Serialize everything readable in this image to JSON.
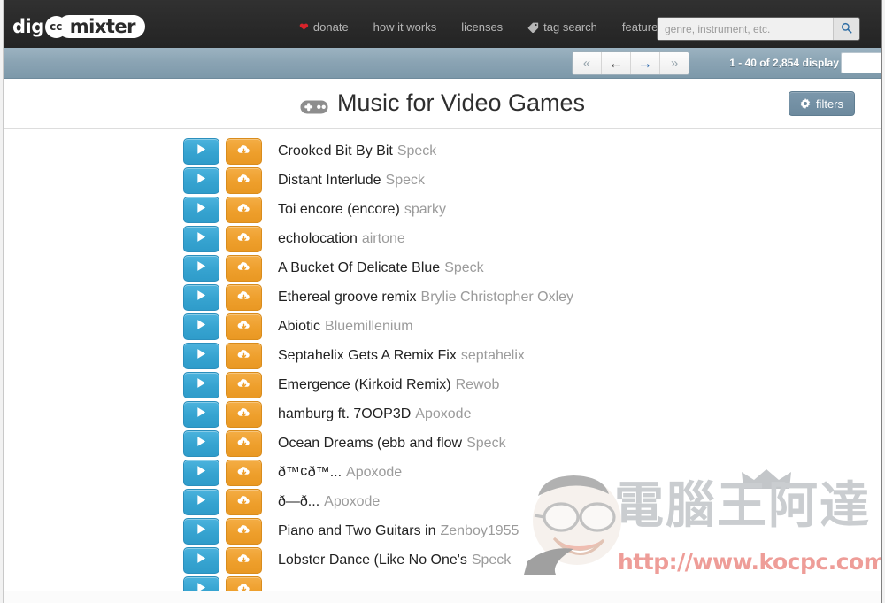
{
  "site": {
    "logo_part1": "dig",
    "logo_badge": "cc",
    "logo_part2": "mixter"
  },
  "header": {
    "nav": [
      {
        "label": "donate",
        "icon": "heart-icon"
      },
      {
        "label": "how it works",
        "icon": null
      },
      {
        "label": "licenses",
        "icon": null
      },
      {
        "label": "tag search",
        "icon": "tag-icon"
      },
      {
        "label": "featured",
        "icon": "chevron-down-icon"
      }
    ],
    "search": {
      "placeholder": "genre, instrument, etc.",
      "value": "",
      "button_icon": "search-icon"
    }
  },
  "toolbar": {
    "pager": [
      {
        "name": "first-page",
        "glyph": "«",
        "style": "muted"
      },
      {
        "name": "prev-page",
        "glyph": "←",
        "style": "dark"
      },
      {
        "name": "next-page",
        "glyph": "→",
        "style": "active"
      },
      {
        "name": "last-page",
        "glyph": "»",
        "style": "muted"
      }
    ],
    "results_text": "1 - 40 of 2,854",
    "display_label": "display",
    "display_value": ""
  },
  "main": {
    "title": "Music for Video Games",
    "title_icon": "gamepad-icon",
    "filters_label": "filters",
    "filters_icon": "gear-icon"
  },
  "tracks": [
    {
      "title": "Crooked Bit By Bit",
      "artist": "Speck"
    },
    {
      "title": "Distant Interlude",
      "artist": "Speck"
    },
    {
      "title": "Toi encore (encore)",
      "artist": "sparky"
    },
    {
      "title": "echolocation",
      "artist": "airtone"
    },
    {
      "title": "A Bucket Of Delicate Blue",
      "artist": "Speck"
    },
    {
      "title": "Ethereal groove remix",
      "artist": "Brylie Christopher Oxley"
    },
    {
      "title": "Abiotic",
      "artist": "Bluemillenium"
    },
    {
      "title": "Septahelix Gets A Remix Fix",
      "artist": "septahelix"
    },
    {
      "title": "Emergence (Kirkoid Remix)",
      "artist": "Rewob"
    },
    {
      "title": "hamburg ft. 7OOP3D",
      "artist": "Apoxode"
    },
    {
      "title": "Ocean Dreams (ebb and flow",
      "artist": "Speck"
    },
    {
      "title": "ð™¢ð™...",
      "artist": "Apoxode"
    },
    {
      "title": "ð—ð...",
      "artist": "Apoxode"
    },
    {
      "title": "Piano and Two Guitars in",
      "artist": "Zenboy1955"
    },
    {
      "title": "Lobster Dance (Like No One's",
      "artist": "Speck"
    },
    {
      "title": "",
      "artist": ""
    }
  ],
  "row_buttons": {
    "play_icon": "play-icon",
    "download_icon": "cloud-download-icon"
  },
  "watermark": {
    "text_cn": "電腦王阿達",
    "url": "http://www.kocpc.com.tw"
  },
  "colors": {
    "header_bg": "#2b2b2b",
    "toolbar_bg": "#8ba4b4",
    "play_blue": "#36a3d0",
    "download_orange": "#ee9f2c",
    "artist_gray": "#9b9b9b",
    "heart_red": "#d8232a",
    "watermark_red": "#e0443c"
  }
}
